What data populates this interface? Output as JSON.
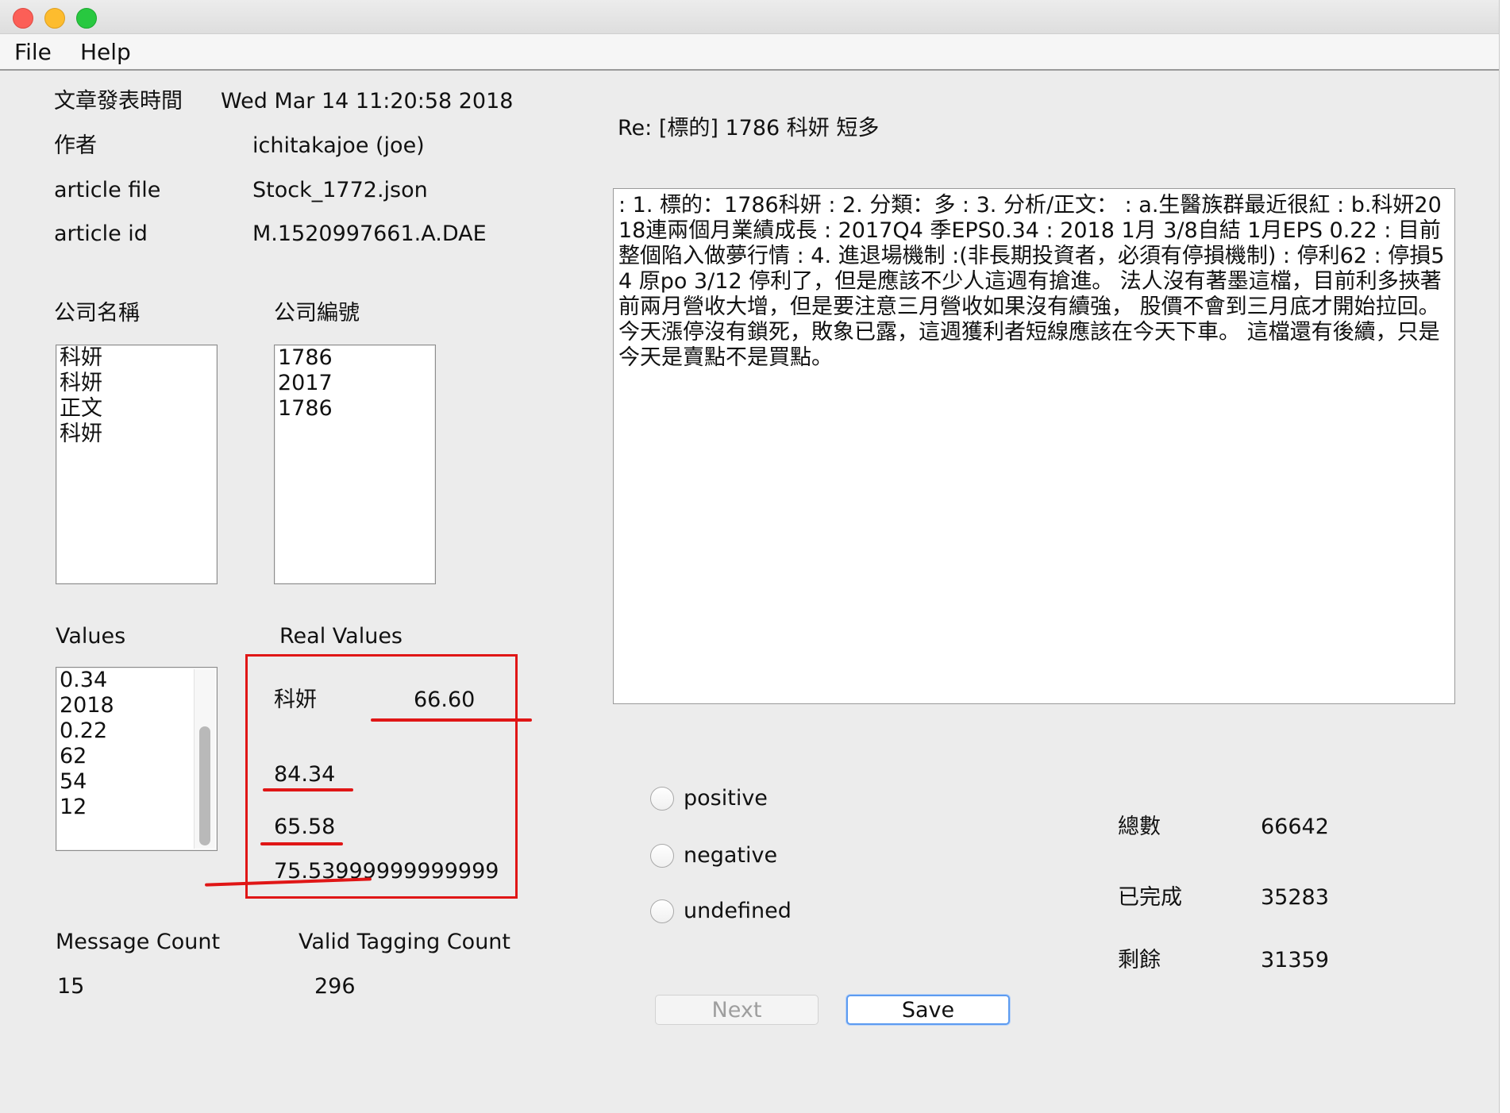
{
  "menu": {
    "file": "File",
    "help": "Help"
  },
  "meta": {
    "post_time_label": "文章發表時間",
    "post_time_value": "Wed Mar 14 11:20:58 2018",
    "author_label": "作者",
    "author_value": "ichitakajoe (joe)",
    "file_label": "article file",
    "file_value": "Stock_1772.json",
    "id_label": "article id",
    "id_value": "M.1520997661.A.DAE"
  },
  "article": {
    "title": "Re: [標的] 1786 科妍 短多",
    "body": ": 1. 標的：1786科妍 : 2. 分類：多 : 3. 分析/正文： : a.生醫族群最近很紅 : b.科妍2018連兩個月業績成長 : 2017Q4 季EPS0.34 : 2018 1月 3/8自結 1月EPS 0.22 : 目前整個陷入做夢行情 : 4. 進退場機制 :(非長期投資者，必須有停損機制) : 停利62 : 停損54 原po 3/12 停利了，但是應該不少人這週有搶進。 法人沒有著墨這檔，目前利多挾著前兩月營收大增，但是要注意三月營收如果沒有續強， 股價不會到三月底才開始拉回。 今天漲停沒有鎖死，敗象已露，這週獲利者短線應該在今天下車。 這檔還有後續，只是今天是賣點不是買點。"
  },
  "company": {
    "name_header": "公司名稱",
    "code_header": "公司編號",
    "names": [
      "科妍",
      "科妍",
      "正文",
      "科妍"
    ],
    "codes": [
      "1786",
      "2017",
      "1786"
    ]
  },
  "values": {
    "header": "Values",
    "items": [
      "0.34",
      "2018",
      "0.22",
      "62",
      "54",
      "12"
    ],
    "scroll_fraction_top": 0.35
  },
  "real_values": {
    "header": "Real Values",
    "company": "科妍",
    "price": "66.60",
    "v1": "84.34",
    "v2": "65.58",
    "v3": "75.53999999999999"
  },
  "counts": {
    "message_label": "Message Count",
    "message_value": "15",
    "valid_label": "Valid Tagging Count",
    "valid_value": "296"
  },
  "sentiment": {
    "positive": "positive",
    "negative": "negative",
    "undefined": "undefined",
    "selected": null
  },
  "stats": {
    "total_label": "總數",
    "total_value": "66642",
    "done_label": "已完成",
    "done_value": "35283",
    "remaining_label": "剩餘",
    "remaining_value": "31359"
  },
  "buttons": {
    "next": "Next",
    "save": "Save"
  },
  "colors": {
    "annotation_red": "#e01616",
    "focus_blue": "#5d9bf0"
  }
}
